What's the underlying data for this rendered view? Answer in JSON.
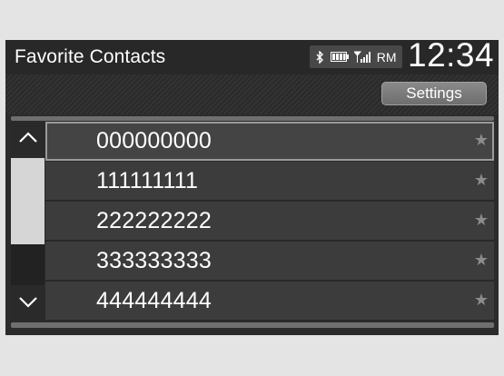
{
  "header": {
    "title": "Favorite Contacts",
    "status": {
      "bluetooth_icon": "bluetooth-icon",
      "battery_icon": "battery-icon",
      "signal_icon": "signal-icon",
      "roaming": "RM"
    },
    "clock": "12:34"
  },
  "toolbar": {
    "settings_label": "Settings"
  },
  "contacts": [
    {
      "number": "000000000",
      "favorite_icon": "star-icon"
    },
    {
      "number": "111111111",
      "favorite_icon": "star-icon"
    },
    {
      "number": "222222222",
      "favorite_icon": "star-icon"
    },
    {
      "number": "333333333",
      "favorite_icon": "star-icon"
    },
    {
      "number": "444444444",
      "favorite_icon": "star-icon"
    }
  ],
  "scroll": {
    "up_icon": "chevron-up-icon",
    "down_icon": "chevron-down-icon"
  },
  "star_glyph": "★",
  "colors": {
    "background": "#2b2b2b",
    "row": "#3c3c3c",
    "accent": "#9a9a9a"
  }
}
